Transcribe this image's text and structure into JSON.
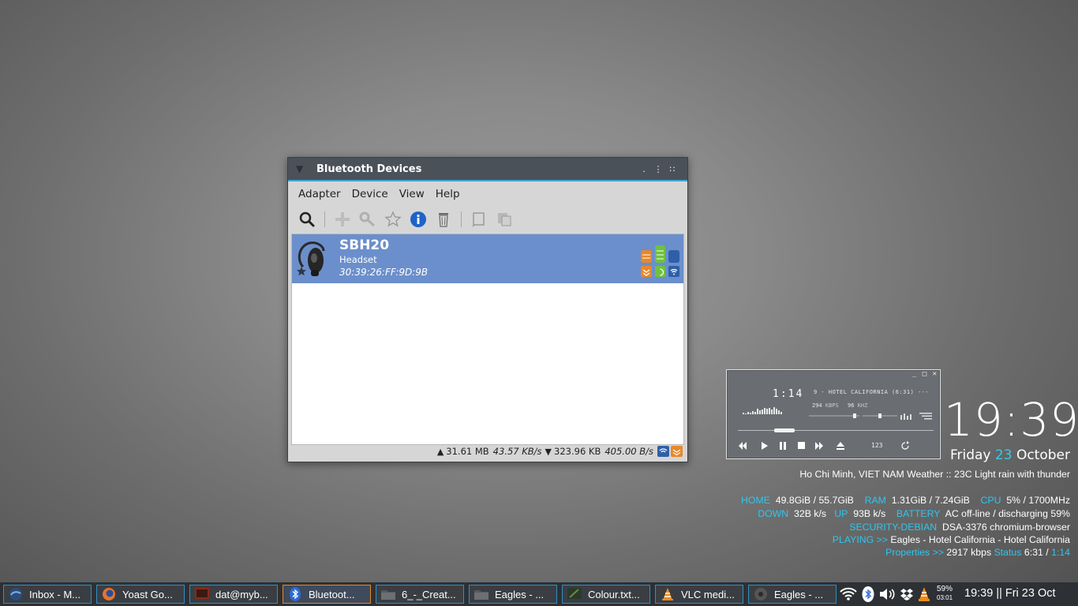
{
  "bluetooth_window": {
    "title": "Bluetooth Devices",
    "menu": [
      "Adapter",
      "Device",
      "View",
      "Help"
    ],
    "toolbar": [
      "search-icon",
      "add-icon",
      "key-icon",
      "star-icon",
      "info-icon",
      "trash-icon",
      "send-file-icon",
      "copy-icon"
    ],
    "device": {
      "name": "SBH20",
      "type": "Headset",
      "address": "30:39:26:FF:9D:9B",
      "selected": true,
      "service_colors": [
        "#e8872a",
        "#6ec23e",
        "#2f5fa8"
      ]
    },
    "status": {
      "sent": "31.61 MB",
      "sent_rate": "43.57 KB/s",
      "received": "323.96 KB",
      "received_rate": "405.00 B/s"
    }
  },
  "player": {
    "time": "1:14",
    "track": "9 - HOTEL CALIFORNIA (6:31) ---",
    "kbps": "294",
    "kbps_label": "KBPS",
    "khz": "96",
    "khz_label": "KHZ",
    "playlist_label": "123",
    "progress_fraction": 0.19
  },
  "desktop": {
    "clock": "19:39",
    "day": "Friday",
    "date_num": "23",
    "month": "October",
    "weather": "Ho Chi Minh, VIET NAM Weather :: 23C Light rain with thunder",
    "home_label": "HOME",
    "home_value": "49.8GiB / 55.7GiB",
    "ram_label": "RAM",
    "ram_value": "1.31GiB / 7.24GiB",
    "cpu_label": "CPU",
    "cpu_value": "5% / 1700MHz",
    "down_label": "DOWN",
    "down_value": "32B  k/s",
    "up_label": "UP",
    "up_value": "93B  k/s",
    "battery_label": "BATTERY",
    "battery_value": "AC off-line / discharging 59%",
    "security_label": "SECURITY-DEBIAN",
    "security_value": "DSA-3376 chromium-browser",
    "playing_label": "PLAYING >>",
    "playing_value": "Eagles - Hotel California - Hotel California",
    "properties_label": "Properties >>",
    "properties_value": "2917 kbps",
    "status_label": "Status",
    "status_total": "6:31",
    "status_sep": "/",
    "status_elapsed": "1:14"
  },
  "taskbar": {
    "tasks": [
      {
        "label": "Inbox - M...",
        "icon": "thunderbird-icon"
      },
      {
        "label": "Yoast Go...",
        "icon": "firefox-icon"
      },
      {
        "label": "dat@myb...",
        "icon": "terminal-icon"
      },
      {
        "label": "Bluetoot...",
        "icon": "bluetooth-icon"
      },
      {
        "label": "6_-_Creat...",
        "icon": "folder-icon"
      },
      {
        "label": "Eagles - ...",
        "icon": "folder-icon"
      },
      {
        "label": "Colour.txt...",
        "icon": "text-editor-icon"
      },
      {
        "label": "VLC medi...",
        "icon": "vlc-icon"
      },
      {
        "label": "Eagles - ...",
        "icon": "music-player-icon"
      }
    ],
    "battery_percent": "59%",
    "battery_time": "03:01",
    "clock": "19:39 || Fri 23 Oct"
  }
}
